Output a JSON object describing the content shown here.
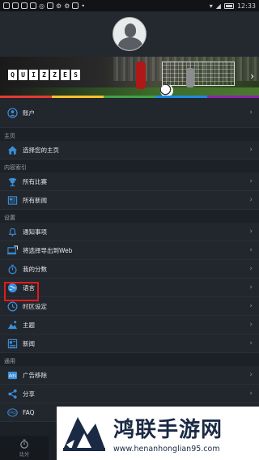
{
  "status_bar": {
    "time": "12:33"
  },
  "banner": {
    "letters": [
      "Q",
      "U",
      "I",
      "Z",
      "Z",
      "E",
      "S"
    ]
  },
  "menu": [
    {
      "type": "row",
      "name": "account-item",
      "label": "账户",
      "icon": "person-icon"
    },
    {
      "type": "section",
      "label": "主页"
    },
    {
      "type": "row",
      "name": "choose-home-item",
      "label": "选择您的主页",
      "icon": "home-icon"
    },
    {
      "type": "section",
      "label": "内容索引"
    },
    {
      "type": "row",
      "name": "all-matches-item",
      "label": "所有比赛",
      "icon": "trophy-icon"
    },
    {
      "type": "row",
      "name": "all-news-item",
      "label": "所有新闻",
      "icon": "news-icon"
    },
    {
      "type": "section",
      "label": "设置"
    },
    {
      "type": "row",
      "name": "notifications-item",
      "label": "通知事项",
      "icon": "bell-icon"
    },
    {
      "type": "row",
      "name": "export-web-item",
      "label": "将选择导出到Web",
      "icon": "export-icon"
    },
    {
      "type": "row",
      "name": "my-score-item",
      "label": "我的分数",
      "icon": "stopwatch-icon"
    },
    {
      "type": "row",
      "name": "language-item",
      "label": "语言",
      "icon": "language-icon"
    },
    {
      "type": "row",
      "name": "timezone-item",
      "label": "时区设定",
      "icon": "clock-icon"
    },
    {
      "type": "row",
      "name": "theme-item",
      "label": "主题",
      "icon": "theme-icon"
    },
    {
      "type": "row",
      "name": "news-item",
      "label": "新闻",
      "icon": "newspaper-icon"
    },
    {
      "type": "section",
      "label": "通用"
    },
    {
      "type": "row",
      "name": "remove-ads-item",
      "label": "广告移除",
      "icon": "ads-icon"
    },
    {
      "type": "row",
      "name": "share-item",
      "label": "分享",
      "icon": "share-icon"
    },
    {
      "type": "row",
      "name": "faq-item",
      "label": "FAQ",
      "icon": "faq-icon"
    }
  ],
  "tabbar": {
    "label": "比分"
  },
  "watermark": {
    "title": "鸿联手游网",
    "url": "www.henanhonglian95.com"
  },
  "colors": {
    "accent": "#3b8fd9",
    "highlight": "#e21b1b",
    "background": "#1c2027"
  }
}
